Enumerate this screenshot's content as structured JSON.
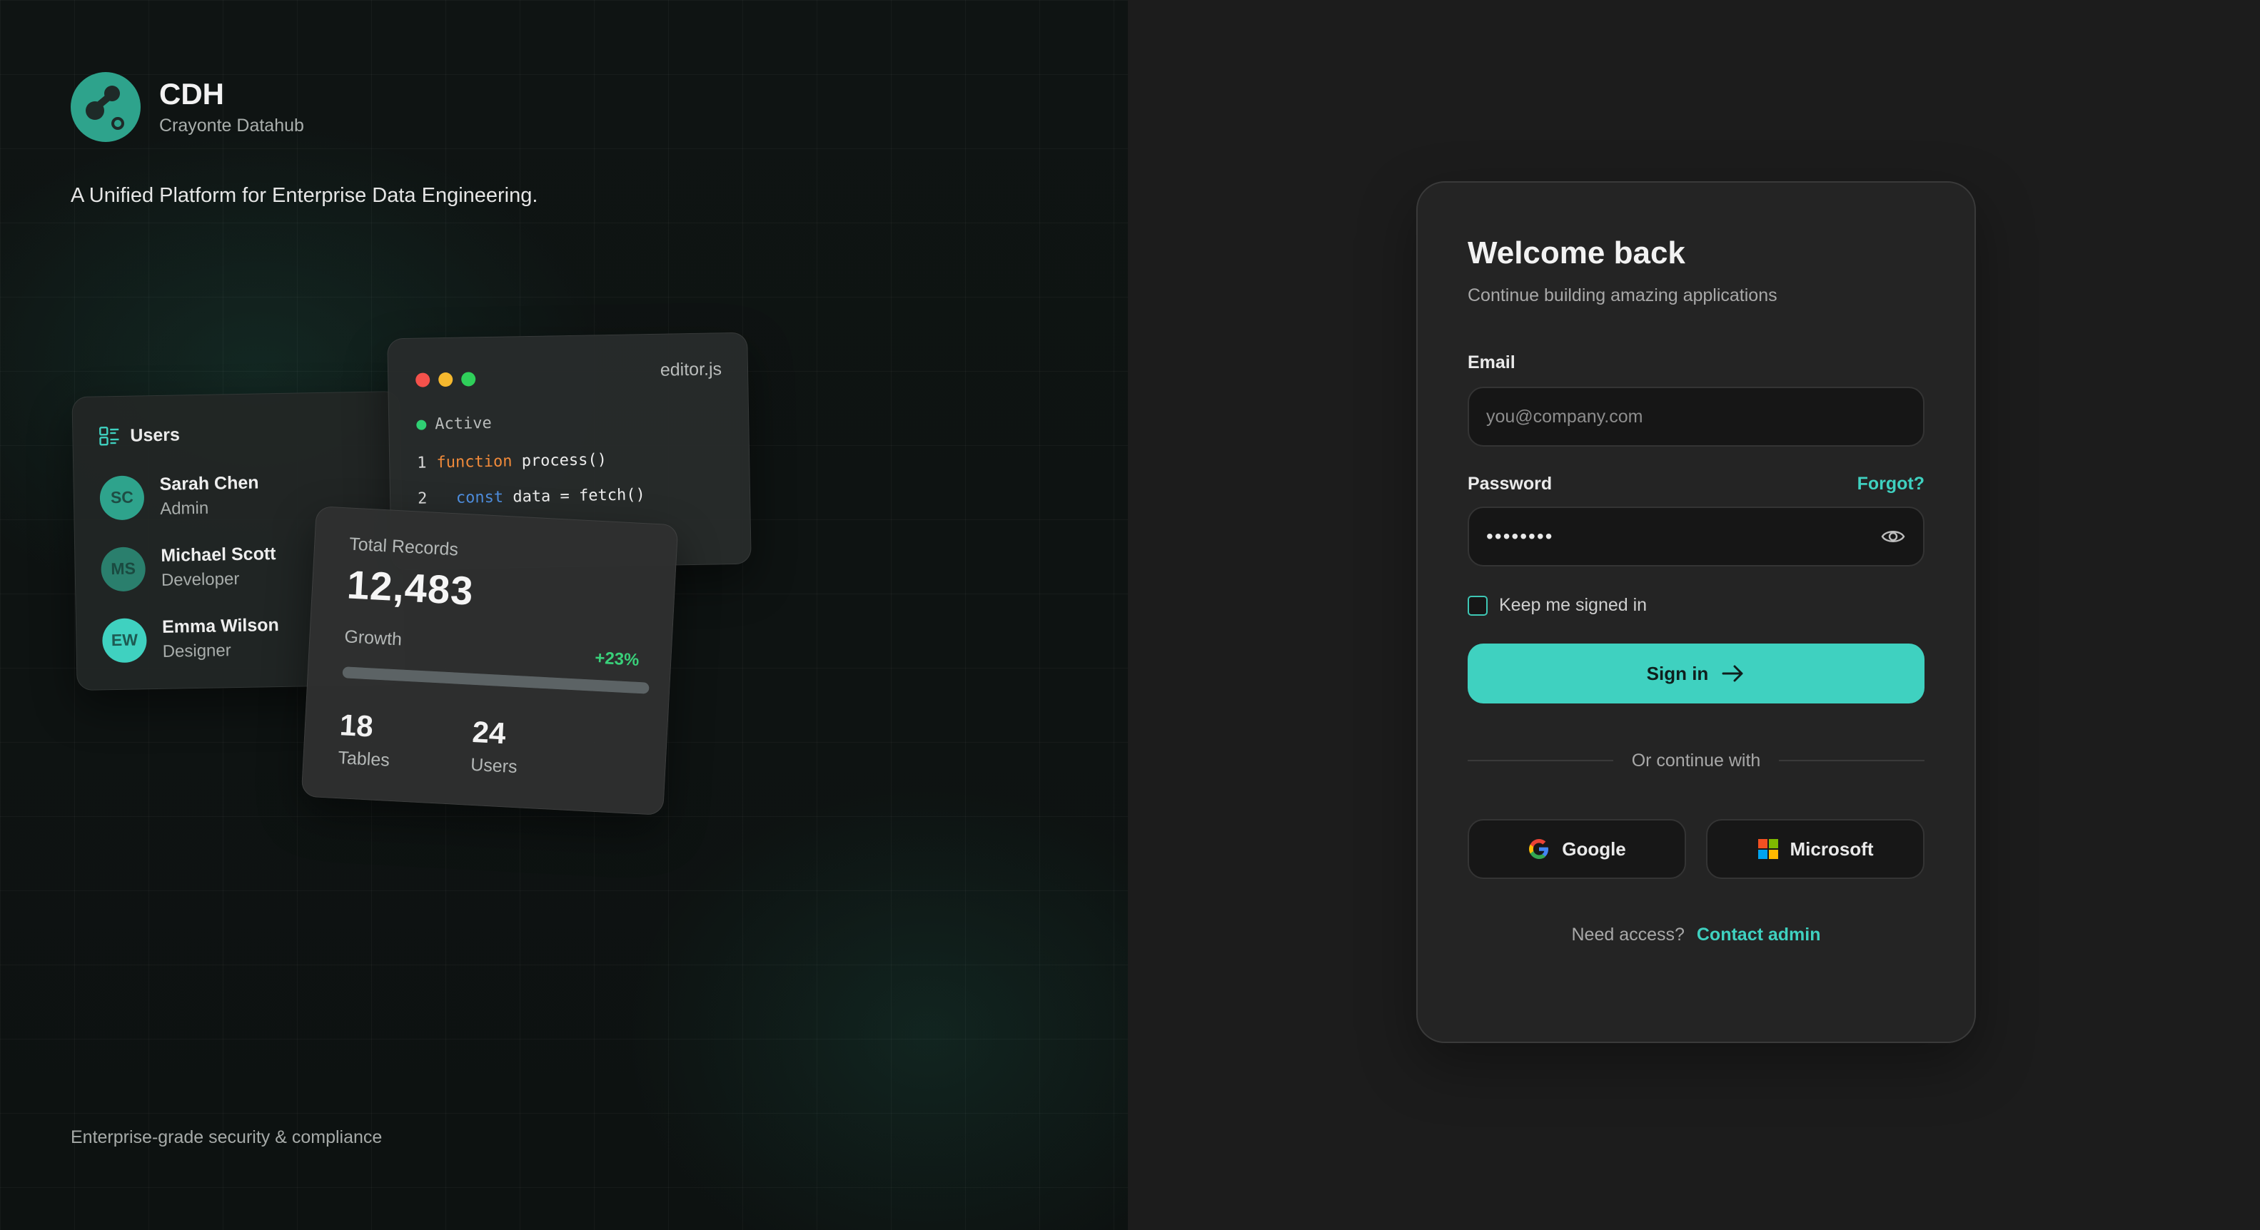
{
  "brand": {
    "name": "CDH",
    "subtitle": "Crayonte Datahub",
    "tagline": "A Unified Platform for Enterprise Data Engineering.",
    "footer": "Enterprise-grade security & compliance"
  },
  "users_card": {
    "title": "Users",
    "users": [
      {
        "initials": "SC",
        "name": "Sarah Chen",
        "role": "Admin",
        "color": "#2ea38c"
      },
      {
        "initials": "MS",
        "name": "Michael Scott",
        "role": "Developer",
        "color": "#2a7f6d"
      },
      {
        "initials": "EW",
        "name": "Emma Wilson",
        "role": "Designer",
        "color": "#3fd1c0"
      }
    ]
  },
  "editor_card": {
    "filename": "editor.js",
    "status": "Active",
    "lines": [
      {
        "num": "1",
        "keyword": "function",
        "rest": " process()"
      },
      {
        "num": "2",
        "keyword": "const",
        "rest": " data = fetch()"
      }
    ]
  },
  "stats_card": {
    "label": "Total Records",
    "total": "12,483",
    "growth_label": "Growth",
    "growth_value": "+23%",
    "growth_fraction": 1.0,
    "tables_value": "18",
    "tables_label": "Tables",
    "users_value": "24",
    "users_label": "Users"
  },
  "login": {
    "title": "Welcome back",
    "subtitle": "Continue building amazing applications",
    "email_label": "Email",
    "email_placeholder": "you@company.com",
    "password_label": "Password",
    "forgot": "Forgot?",
    "password_value": "••••••••",
    "remember": "Keep me signed in",
    "signin": "Sign in",
    "divider": "Or continue with",
    "google": "Google",
    "microsoft": "Microsoft",
    "access_question": "Need access?",
    "access_link": "Contact admin"
  },
  "colors": {
    "accent": "#3fd1c0",
    "brand": "#2ea38c",
    "growth": "#39d07a",
    "dot_red": "#f4514b",
    "dot_yellow": "#f5b82e",
    "dot_green": "#2fcf5a"
  },
  "icons": [
    "logo-icon",
    "list-icon",
    "eye-icon",
    "arrow-right-icon",
    "google-icon",
    "microsoft-icon"
  ]
}
